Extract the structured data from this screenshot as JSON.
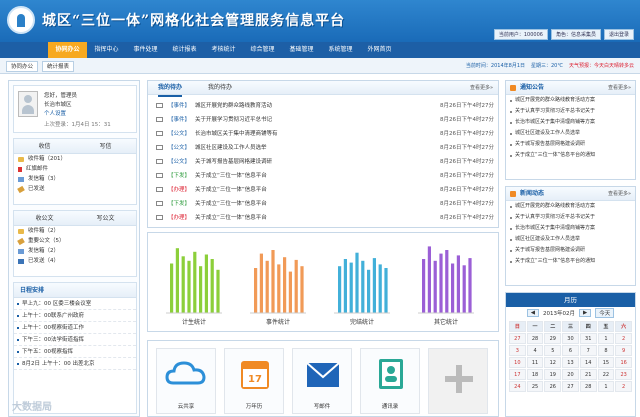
{
  "header": {
    "title": "城区“三位一体”网格化社会管理服务信息平台",
    "user_button": "当前用户：100006",
    "role_button": "角色：信息采集员",
    "logout_button": "退出登录"
  },
  "nav": [
    "协同办公",
    "指挥中心",
    "事件处理",
    "统计报表",
    "考核统计",
    "综合管理",
    "基础管理",
    "系统管理",
    "外网首页"
  ],
  "subtabs": [
    "协同办公",
    "统计报表"
  ],
  "status": {
    "date": "当前时间：2014年8月1日",
    "week": "星期三：20℃",
    "weather": "天气预报：今天白天晴转多云"
  },
  "user": {
    "greeting": "您好，管理员",
    "org": "长治市城区",
    "link": "个人设置",
    "time": "上次登录：1月4日 15：31"
  },
  "mailbox": {
    "tabs": [
      "收信",
      "写信"
    ],
    "items": [
      "收件箱（201）",
      "红旗邮件",
      "发信箱（3）",
      "已发送"
    ]
  },
  "docs": {
    "tabs": [
      "收公文",
      "写公文"
    ],
    "items": [
      "收件箱（2）",
      "重要公文（5）",
      "发信箱（2）",
      "已发送（4）"
    ]
  },
  "schedule": {
    "title": "日程安排",
    "items": [
      "早上九：00 区委三楼会议室",
      "上午十：00联系广州政府",
      "上午十：00视察街道工作",
      "下午三：00法学街道指挥",
      "下午五：00视察指挥",
      "8月2日 上午十：00 出差北京"
    ]
  },
  "tasks": {
    "tabs": [
      "我的待办",
      "我的待办"
    ],
    "more": "查看更多»",
    "rows": [
      {
        "tag": "【事件】",
        "text": "城区开展党的群众路线教育活动",
        "date": "8月26日下午4时27分"
      },
      {
        "tag": "【事件】",
        "text": "关于开展学习贯彻习近平总书记",
        "date": "8月26日下午4时27分"
      },
      {
        "tag": "【公文】",
        "text": "长治市城区关于集中清理商铺等有",
        "date": "8月26日下午4时27分"
      },
      {
        "tag": "【公文】",
        "text": "城区社区建设及工作人员选举",
        "date": "8月26日下午4时27分"
      },
      {
        "tag": "【公文】",
        "text": "关于城写报告基层网格建设调研",
        "date": "8月26日下午4时27分"
      },
      {
        "tag": "【下发】",
        "text": "关于成立“三位一体”信息平台",
        "date": "8月26日下午4时27分"
      },
      {
        "tag": "【办理】",
        "text": "关于成立“三位一体”信息平台",
        "date": "8月26日下午4时27分"
      },
      {
        "tag": "【下发】",
        "text": "关于成立“三位一体”信息平台",
        "date": "8月26日下午4时27分"
      },
      {
        "tag": "【办理】",
        "text": "关于成立“三位一体”信息平台",
        "date": "8月26日下午4时27分"
      }
    ]
  },
  "chart_data": {
    "type": "bar",
    "categories": [
      "计生统计",
      "事件统计",
      "完结统计",
      "其它统计"
    ],
    "series": [
      {
        "values": [
          55,
          72,
          63,
          58,
          68,
          52,
          65,
          60,
          48
        ]
      },
      {
        "values": [
          50,
          66,
          58,
          70,
          54,
          62,
          46,
          59,
          52
        ]
      },
      {
        "values": [
          52,
          60,
          56,
          67,
          58,
          48,
          61,
          54,
          50
        ]
      },
      {
        "values": [
          60,
          74,
          58,
          66,
          70,
          55,
          64,
          53,
          61
        ]
      }
    ],
    "colors": [
      "#8ccf3a",
      "#f19a57",
      "#42b0d9",
      "#9b5fd6"
    ],
    "ylim": [
      0,
      80
    ]
  },
  "apps": [
    "云共享",
    "万年历",
    "写邮件",
    "通讯录",
    ""
  ],
  "notices": {
    "title": "通知公告",
    "more": "查看更多»",
    "items": [
      "城区开展党的群众路线教育活动方案",
      "关于认真学习贯彻习近平总书记关于",
      "长治市城区关于集中清理商铺等方案",
      "城区社区建设及工作人员选举",
      "关于城写报告基层网格建设调研",
      "关于成立“三位一体”信息平台的通知"
    ]
  },
  "news": {
    "title": "新闻动态",
    "more": "查看更多»",
    "items": [
      "城区开展党的群众路线教育活动方案",
      "关于认真学习贯彻习近平总书记关于",
      "长治市城区关于集中清理商铺等方案",
      "城区社区建设及工作人员选举",
      "关于城写报告基层网格建设调研",
      "关于成立“三位一体”信息平台的通知"
    ]
  },
  "calendar": {
    "title": "月历",
    "month": "2013年02月",
    "today_btn": "今天",
    "weekdays": [
      "日",
      "一",
      "二",
      "三",
      "四",
      "五",
      "六"
    ],
    "days": [
      "27",
      "28",
      "29",
      "30",
      "31",
      "1",
      "2",
      "3",
      "4",
      "5",
      "6",
      "7",
      "8",
      "9",
      "10",
      "11",
      "12",
      "13",
      "14",
      "15",
      "16",
      "17",
      "18",
      "19",
      "20",
      "21",
      "22",
      "23",
      "24",
      "25",
      "26",
      "27",
      "28",
      "1",
      "2"
    ]
  },
  "watermark": "大数据局"
}
